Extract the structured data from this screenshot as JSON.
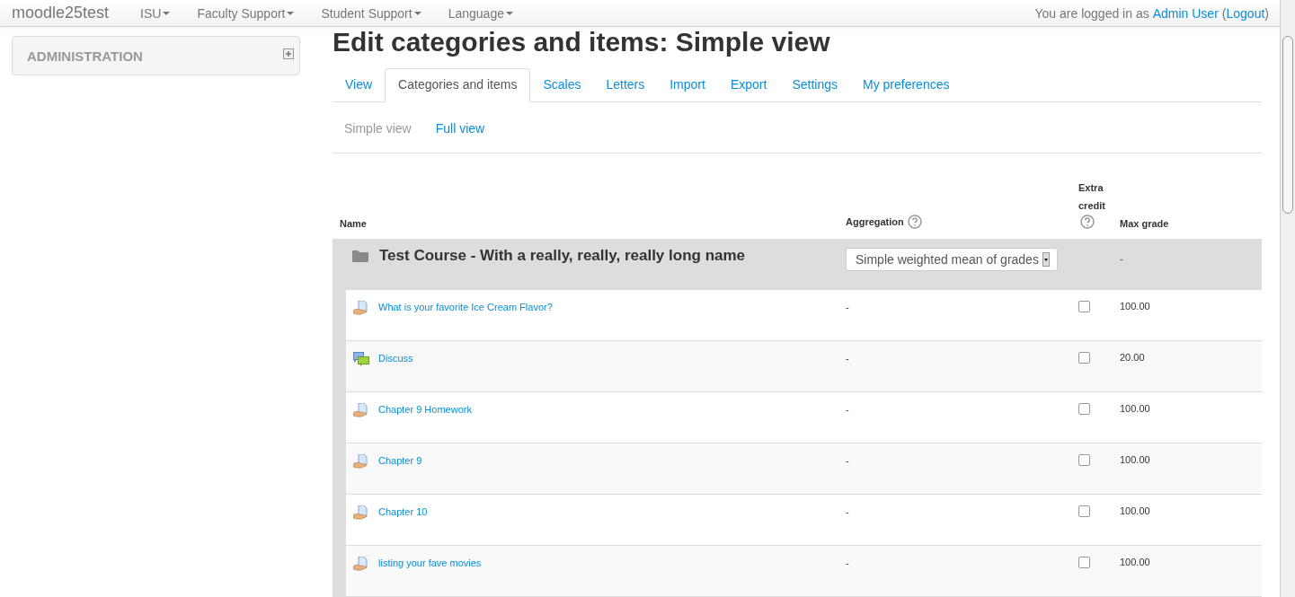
{
  "navbar": {
    "brand": "moodle25test",
    "menus": [
      {
        "label": "ISU"
      },
      {
        "label": "Faculty Support"
      },
      {
        "label": "Student Support"
      },
      {
        "label": "Language"
      }
    ],
    "login": {
      "prefix": "You are logged in as",
      "user": "Admin User",
      "open_paren": "(",
      "logout": "Logout",
      "close_paren": ")"
    }
  },
  "sidebar": {
    "block_title": "ADMINISTRATION"
  },
  "page_title": "Edit categories and items: Simple view",
  "tabs": [
    {
      "label": "View",
      "selected": false
    },
    {
      "label": "Categories and items",
      "selected": true
    },
    {
      "label": "Scales",
      "selected": false
    },
    {
      "label": "Letters",
      "selected": false
    },
    {
      "label": "Import",
      "selected": false
    },
    {
      "label": "Export",
      "selected": false
    },
    {
      "label": "Settings",
      "selected": false
    },
    {
      "label": "My preferences",
      "selected": false
    }
  ],
  "subtabs": [
    {
      "label": "Simple view",
      "selected": true
    },
    {
      "label": "Full view",
      "selected": false
    }
  ],
  "table": {
    "columns": {
      "name": "Name",
      "aggregation": "Aggregation",
      "extra_credit": [
        "Extra",
        "credit"
      ],
      "max_grade": "Max grade"
    },
    "category": {
      "name": "Test Course - With a really, really, really long name",
      "aggregation": "Simple weighted mean of grades",
      "max_grade": "-"
    },
    "rows": [
      {
        "kind": "assignment",
        "name": "What is your favorite Ice Cream Flavor?",
        "aggregation": "-",
        "extra_credit": false,
        "max_grade": "100.00"
      },
      {
        "kind": "forum",
        "name": "Discuss",
        "aggregation": "-",
        "extra_credit": false,
        "max_grade": "20.00"
      },
      {
        "kind": "assignment",
        "name": "Chapter 9 Homework",
        "aggregation": "-",
        "extra_credit": false,
        "max_grade": "100.00"
      },
      {
        "kind": "assignment",
        "name": "Chapter 9",
        "aggregation": "-",
        "extra_credit": false,
        "max_grade": "100.00"
      },
      {
        "kind": "assignment",
        "name": "Chapter 10",
        "aggregation": "-",
        "extra_credit": false,
        "max_grade": "100.00"
      },
      {
        "kind": "assignment",
        "name": "listing your fave movies",
        "aggregation": "-",
        "extra_credit": false,
        "max_grade": "100.00"
      }
    ]
  }
}
